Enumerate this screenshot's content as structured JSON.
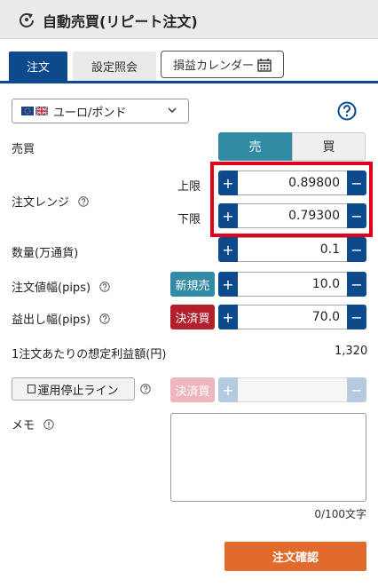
{
  "header": {
    "title": "自動売買(リピート注文)"
  },
  "tabs": {
    "order": "注文",
    "settings": "設定照会",
    "calendar": "損益カレンダー"
  },
  "pair": {
    "label": "ユーロ/ポンド"
  },
  "side": {
    "label": "売買",
    "sell": "売",
    "buy": "買"
  },
  "range": {
    "label": "注文レンジ",
    "upper_label": "上限",
    "upper_value": "0.89800",
    "lower_label": "下限",
    "lower_value": "0.79300"
  },
  "quantity": {
    "label": "数量(万通貨)",
    "value": "0.1"
  },
  "order_width": {
    "label": "注文値幅(pips)",
    "badge": "新規売",
    "value": "10.0"
  },
  "profit_width": {
    "label": "益出し幅(pips)",
    "badge": "決済買",
    "value": "70.0"
  },
  "expected_profit": {
    "label": "1注文あたりの想定利益額(円)",
    "value": "1,320"
  },
  "stoploss": {
    "button": "運用停止ライン",
    "badge": "決済買"
  },
  "memo": {
    "label": "メモ",
    "count": "0/100文字"
  },
  "confirm": {
    "label": "注文確認"
  },
  "stepper": {
    "plus": "+",
    "minus": "−"
  },
  "colors": {
    "primary": "#0d4a8c",
    "sell": "#318ba5",
    "close": "#b3202c",
    "confirm": "#e26a2c",
    "highlight": "#e3001b"
  }
}
